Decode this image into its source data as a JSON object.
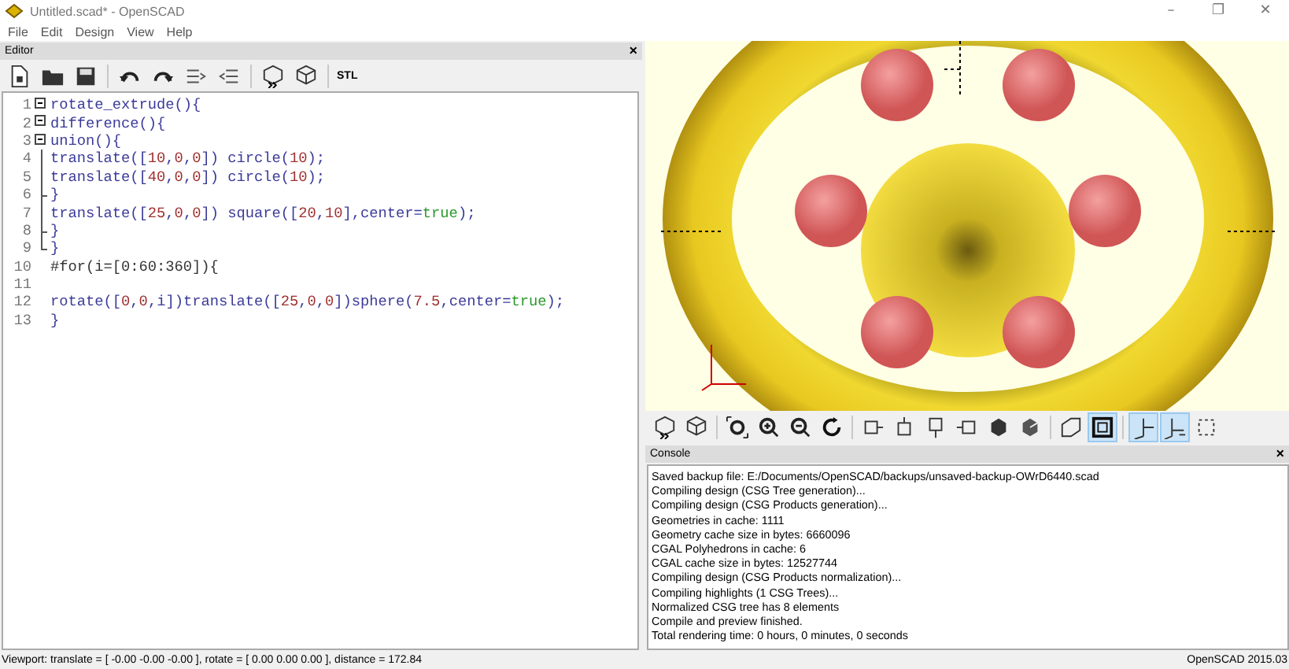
{
  "window": {
    "title": "Untitled.scad* - OpenSCAD",
    "controls": [
      "–",
      "❐",
      "✕"
    ]
  },
  "menu": [
    "File",
    "Edit",
    "Design",
    "View",
    "Help"
  ],
  "editor": {
    "title": "Editor",
    "close": "×",
    "toolbar": [
      {
        "kind": "new"
      },
      {
        "kind": "open"
      },
      {
        "kind": "save"
      },
      {
        "kind": "sep"
      },
      {
        "kind": "undo"
      },
      {
        "kind": "redo"
      },
      {
        "kind": "indent"
      },
      {
        "kind": "unindent"
      },
      {
        "kind": "sep"
      },
      {
        "kind": "preview"
      },
      {
        "kind": "render"
      },
      {
        "kind": "sep"
      },
      {
        "kind": "stl",
        "label": "STL"
      }
    ],
    "lines": [
      {
        "number": "1",
        "kind": "start",
        "tokens": [
          {
            "kind": "text",
            "t": "rotate_extrude(){"
          }
        ]
      },
      {
        "number": "2",
        "kind": "start",
        "tokens": [
          {
            "kind": "text",
            "t": "difference(){"
          }
        ]
      },
      {
        "number": "3",
        "kind": "start",
        "tokens": [
          {
            "kind": "text",
            "t": "union(){"
          }
        ]
      },
      {
        "number": "4",
        "kind": "mid",
        "tokens": [
          {
            "kind": "text",
            "t": "translate(["
          },
          {
            "kind": "number",
            "t": "10"
          },
          {
            "kind": "text",
            "t": ","
          },
          {
            "kind": "number",
            "t": "0"
          },
          {
            "kind": "text",
            "t": ","
          },
          {
            "kind": "number",
            "t": "0"
          },
          {
            "kind": "text",
            "t": "]) circle("
          },
          {
            "kind": "number",
            "t": "10"
          },
          {
            "kind": "text",
            "t": ");"
          }
        ]
      },
      {
        "number": "5",
        "kind": "mid",
        "tokens": [
          {
            "kind": "text",
            "t": "translate(["
          },
          {
            "kind": "number",
            "t": "40"
          },
          {
            "kind": "text",
            "t": ","
          },
          {
            "kind": "number",
            "t": "0"
          },
          {
            "kind": "text",
            "t": ","
          },
          {
            "kind": "number",
            "t": "0"
          },
          {
            "kind": "text",
            "t": "]) circle("
          },
          {
            "kind": "number",
            "t": "10"
          },
          {
            "kind": "text",
            "t": ");"
          }
        ]
      },
      {
        "number": "6",
        "kind": "branch",
        "tokens": [
          {
            "kind": "text",
            "t": "}"
          }
        ]
      },
      {
        "number": "7",
        "kind": "mid",
        "tokens": [
          {
            "kind": "text",
            "t": "translate(["
          },
          {
            "kind": "number",
            "t": "25"
          },
          {
            "kind": "text",
            "t": ","
          },
          {
            "kind": "number",
            "t": "0"
          },
          {
            "kind": "text",
            "t": ","
          },
          {
            "kind": "number",
            "t": "0"
          },
          {
            "kind": "text",
            "t": "]) square(["
          },
          {
            "kind": "number",
            "t": "20"
          },
          {
            "kind": "text",
            "t": ","
          },
          {
            "kind": "number",
            "t": "10"
          },
          {
            "kind": "text",
            "t": "],center="
          },
          {
            "kind": "keyword",
            "t": "true"
          },
          {
            "kind": "text",
            "t": ");"
          }
        ]
      },
      {
        "number": "8",
        "kind": "branch",
        "tokens": [
          {
            "kind": "text",
            "t": "}"
          }
        ]
      },
      {
        "number": "9",
        "kind": "end",
        "tokens": [
          {
            "kind": "text",
            "t": "}"
          }
        ]
      },
      {
        "number": "10",
        "kind": "none",
        "tokens": [
          {
            "kind": "plain",
            "t": "#for(i=["
          },
          {
            "kind": "plain",
            "t": "0:60:360"
          },
          {
            "kind": "plain",
            "t": "]){"
          }
        ]
      },
      {
        "number": "11",
        "kind": "none"
      },
      {
        "number": "12",
        "kind": "none",
        "tokens": [
          {
            "kind": "text",
            "t": "rotate(["
          },
          {
            "kind": "number",
            "t": "0"
          },
          {
            "kind": "text",
            "t": ","
          },
          {
            "kind": "number",
            "t": "0"
          },
          {
            "kind": "text",
            "t": ",i])translate(["
          },
          {
            "kind": "number",
            "t": "25"
          },
          {
            "kind": "text",
            "t": ","
          },
          {
            "kind": "number",
            "t": "0"
          },
          {
            "kind": "text",
            "t": ","
          },
          {
            "kind": "number",
            "t": "0"
          },
          {
            "kind": "text",
            "t": "])sphere("
          },
          {
            "kind": "number",
            "t": "7.5"
          },
          {
            "kind": "text",
            "t": ",center="
          },
          {
            "kind": "keyword",
            "t": "true"
          },
          {
            "kind": "text",
            "t": ");"
          }
        ]
      },
      {
        "number": "13",
        "kind": "none",
        "tokens": [
          {
            "kind": "text",
            "t": "}"
          }
        ]
      }
    ]
  },
  "view_toolbar": [
    {
      "kind": "preview",
      "on": false
    },
    {
      "kind": "render",
      "on": false
    },
    {
      "kind": "sep"
    },
    {
      "kind": "view-all",
      "on": false
    },
    {
      "kind": "zoom-in",
      "on": false
    },
    {
      "kind": "zoom-out",
      "on": false
    },
    {
      "kind": "reset",
      "on": false
    },
    {
      "kind": "sep"
    },
    {
      "kind": "right",
      "on": false
    },
    {
      "kind": "top",
      "on": false
    },
    {
      "kind": "bottom",
      "on": false
    },
    {
      "kind": "left",
      "on": false
    },
    {
      "kind": "front",
      "on": false
    },
    {
      "kind": "back",
      "on": false
    },
    {
      "kind": "sep"
    },
    {
      "kind": "perspective",
      "on": false
    },
    {
      "kind": "orthogonal",
      "on": true
    },
    {
      "kind": "sep"
    },
    {
      "kind": "axes",
      "on": true
    },
    {
      "kind": "scale",
      "on": true
    },
    {
      "kind": "edges",
      "on": false
    }
  ],
  "console": {
    "title": "Console",
    "close": "×",
    "lines": [
      "Saved backup file: E:/Documents/OpenSCAD/backups/unsaved-backup-OWrD6440.scad",
      "Compiling design (CSG Tree generation)...",
      "Compiling design (CSG Products generation)...",
      "Geometries in cache: 1111",
      "Geometry cache size in bytes: 6660096",
      "CGAL Polyhedrons in cache: 6",
      "CGAL cache size in bytes: 12527744",
      "Compiling design (CSG Products normalization)...",
      "Compiling highlights (1 CSG Trees)...",
      "Normalized CSG tree has 8 elements",
      "Compile and preview finished.",
      "Total rendering time: 0 hours, 0 minutes, 0 seconds"
    ]
  },
  "status_bar": {
    "viewport": "Viewport: translate = [ -0.00 -0.00 -0.00 ], rotate = [ 0.00 0.00 0.00 ], distance = 172.84",
    "version": "OpenSCAD 2015.03"
  }
}
